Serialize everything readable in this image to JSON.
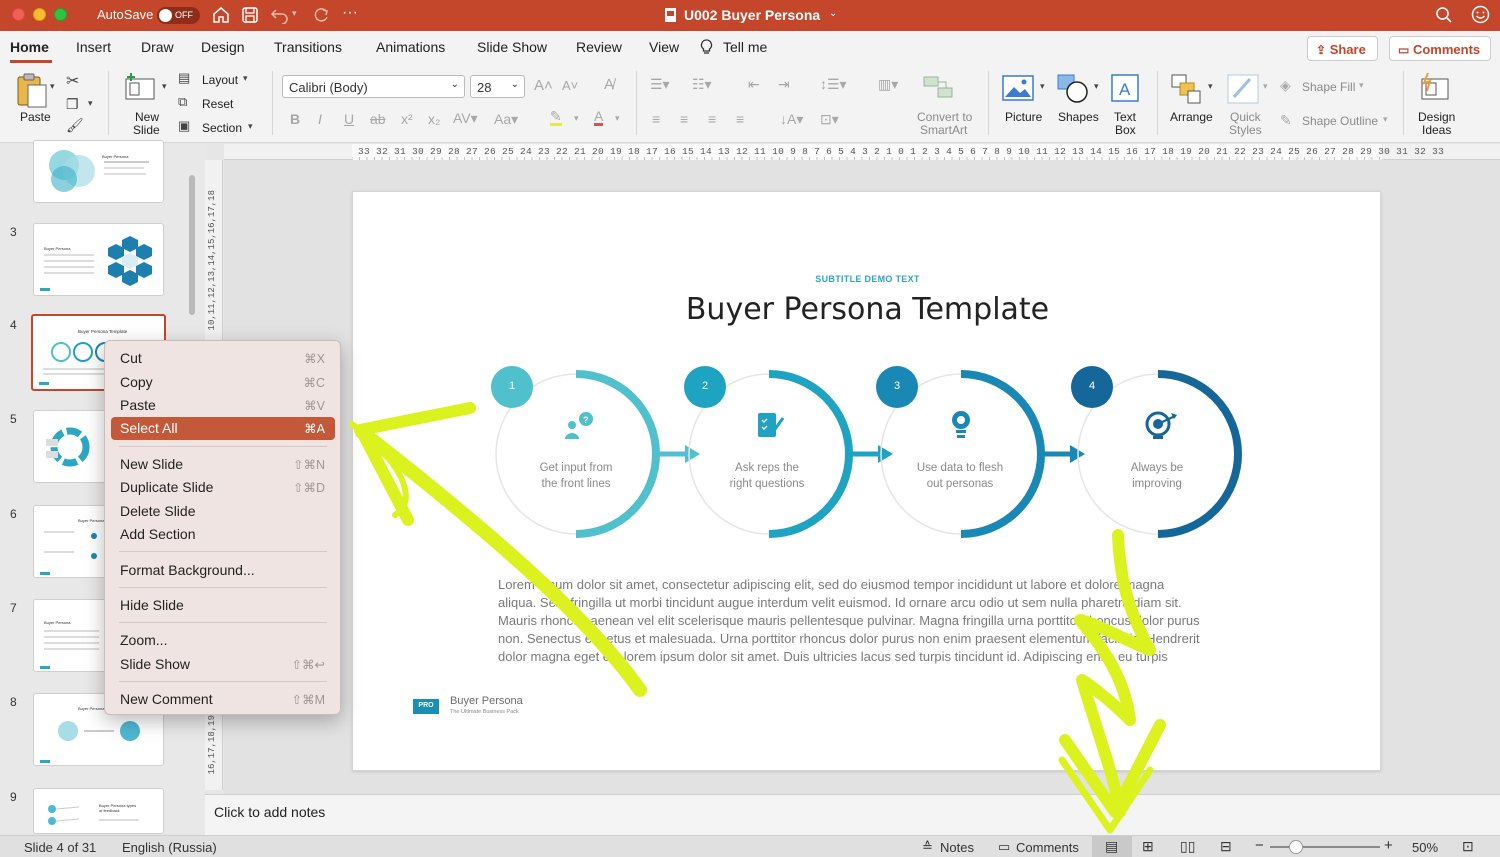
{
  "window": {
    "autosave_label": "AutoSave",
    "autosave_state": "OFF",
    "title": "U002 Buyer Persona",
    "accent_color": "#c4472b"
  },
  "tabs": [
    "Home",
    "Insert",
    "Draw",
    "Design",
    "Transitions",
    "Animations",
    "Slide Show",
    "Review",
    "View",
    "Tell me"
  ],
  "share_label": "Share",
  "comments_label": "Comments",
  "ribbon": {
    "paste": "Paste",
    "new_slide_1": "New",
    "new_slide_2": "Slide",
    "layout": "Layout",
    "reset": "Reset",
    "section": "Section",
    "font_name": "Calibri (Body)",
    "font_size": "28",
    "convert_1": "Convert to",
    "convert_2": "SmartArt",
    "picture": "Picture",
    "shapes": "Shapes",
    "textbox_1": "Text",
    "textbox_2": "Box",
    "arrange": "Arrange",
    "quick_1": "Quick",
    "quick_2": "Styles",
    "shape_fill": "Shape Fill",
    "shape_outline": "Shape Outline",
    "design_ideas_1": "Design",
    "design_ideas_2": "Ideas"
  },
  "thumbnails": {
    "numbers": [
      "3",
      "4",
      "5",
      "6",
      "7",
      "8",
      "9"
    ],
    "tiny_titles": [
      "Buyer Persona",
      "Buyer Persona",
      "Buyer Persona Template",
      "Buyer Persona",
      "Buyer Persona",
      "Buyer Persona",
      "Buyer Persona types of feedback"
    ]
  },
  "ruler": {
    "horizontal": "33,32,31,30,29,28,27,26,25,24,23,22,21,20,19,18,17,16,15,14,13,12,11,10,9,8,7,6,5,4,3,2,1,0,1,2,3,4,5,6,7,8,9,10,11,12,13,14,15,16,17,18,19,20,21,22,23,24,25,26,27,28,29,30,31,32,33",
    "vertical_top": "10,11,12,13,14,15,16,17,18",
    "vertical_bottom": "16,17,18,19"
  },
  "slide": {
    "subtitle": "SUBTITLE DEMO TEXT",
    "title": "Buyer Persona Template",
    "steps": [
      {
        "num": "1",
        "line1": "Get input from",
        "line2": "the front lines",
        "color": "#4fc0cc"
      },
      {
        "num": "2",
        "line1": "Ask reps the",
        "line2": "right questions",
        "color": "#1fa3c2"
      },
      {
        "num": "3",
        "line1": "Use data to flesh",
        "line2": "out personas",
        "color": "#1a88b5"
      },
      {
        "num": "4",
        "line1": "Always be",
        "line2": "improving",
        "color": "#15679a"
      }
    ],
    "body_lines": [
      "Lorem ipsum dolor sit amet, consectetur adipiscing elit, sed do eiusmod tempor incididunt ut labore et dolore magna",
      "aliqua. Sem fringilla ut morbi tincidunt augue interdum velit euismod. Id ornare arcu odio ut sem nulla pharetra diam sit.",
      "Mauris rhoncus aenean vel elit scelerisque mauris pellentesque pulvinar. Magna fringilla urna porttitor rhoncus dolor purus",
      "non. Senectus et netus et malesuada. Urna porttitor rhoncus dolor purus non enim praesent elementum facilisis. Hendrerit",
      "dolor magna eget est lorem ipsum dolor sit amet. Duis ultricies lacus sed turpis tincidunt id. Adipiscing enim eu turpis"
    ],
    "brand_badge": "PRO",
    "brand_name": "Buyer Persona",
    "brand_tagline": "The Ultimate Business Pack"
  },
  "context_menu": [
    {
      "label": "Cut",
      "shortcut": "⌘X"
    },
    {
      "label": "Copy",
      "shortcut": "⌘C"
    },
    {
      "label": "Paste",
      "shortcut": "⌘V"
    },
    {
      "label": "Select All",
      "shortcut": "⌘A",
      "highlighted": true
    },
    {
      "label": "New Slide",
      "shortcut": "⇧⌘N"
    },
    {
      "label": "Duplicate Slide",
      "shortcut": "⇧⌘D"
    },
    {
      "label": "Delete Slide",
      "shortcut": ""
    },
    {
      "label": "Add Section",
      "shortcut": ""
    },
    {
      "label": "Format Background...",
      "shortcut": ""
    },
    {
      "label": "Hide Slide",
      "shortcut": ""
    },
    {
      "label": "Zoom...",
      "shortcut": ""
    },
    {
      "label": "Slide Show",
      "shortcut": "⇧⌘↩"
    },
    {
      "label": "New Comment",
      "shortcut": "⇧⌘M"
    }
  ],
  "notes_placeholder": "Click to add notes",
  "status": {
    "slide_info": "Slide 4 of 31",
    "language": "English (Russia)",
    "notes": "Notes",
    "comments": "Comments",
    "zoom": "50%",
    "zoom_level": 0.5
  },
  "annotation_color": "#dcf21e"
}
